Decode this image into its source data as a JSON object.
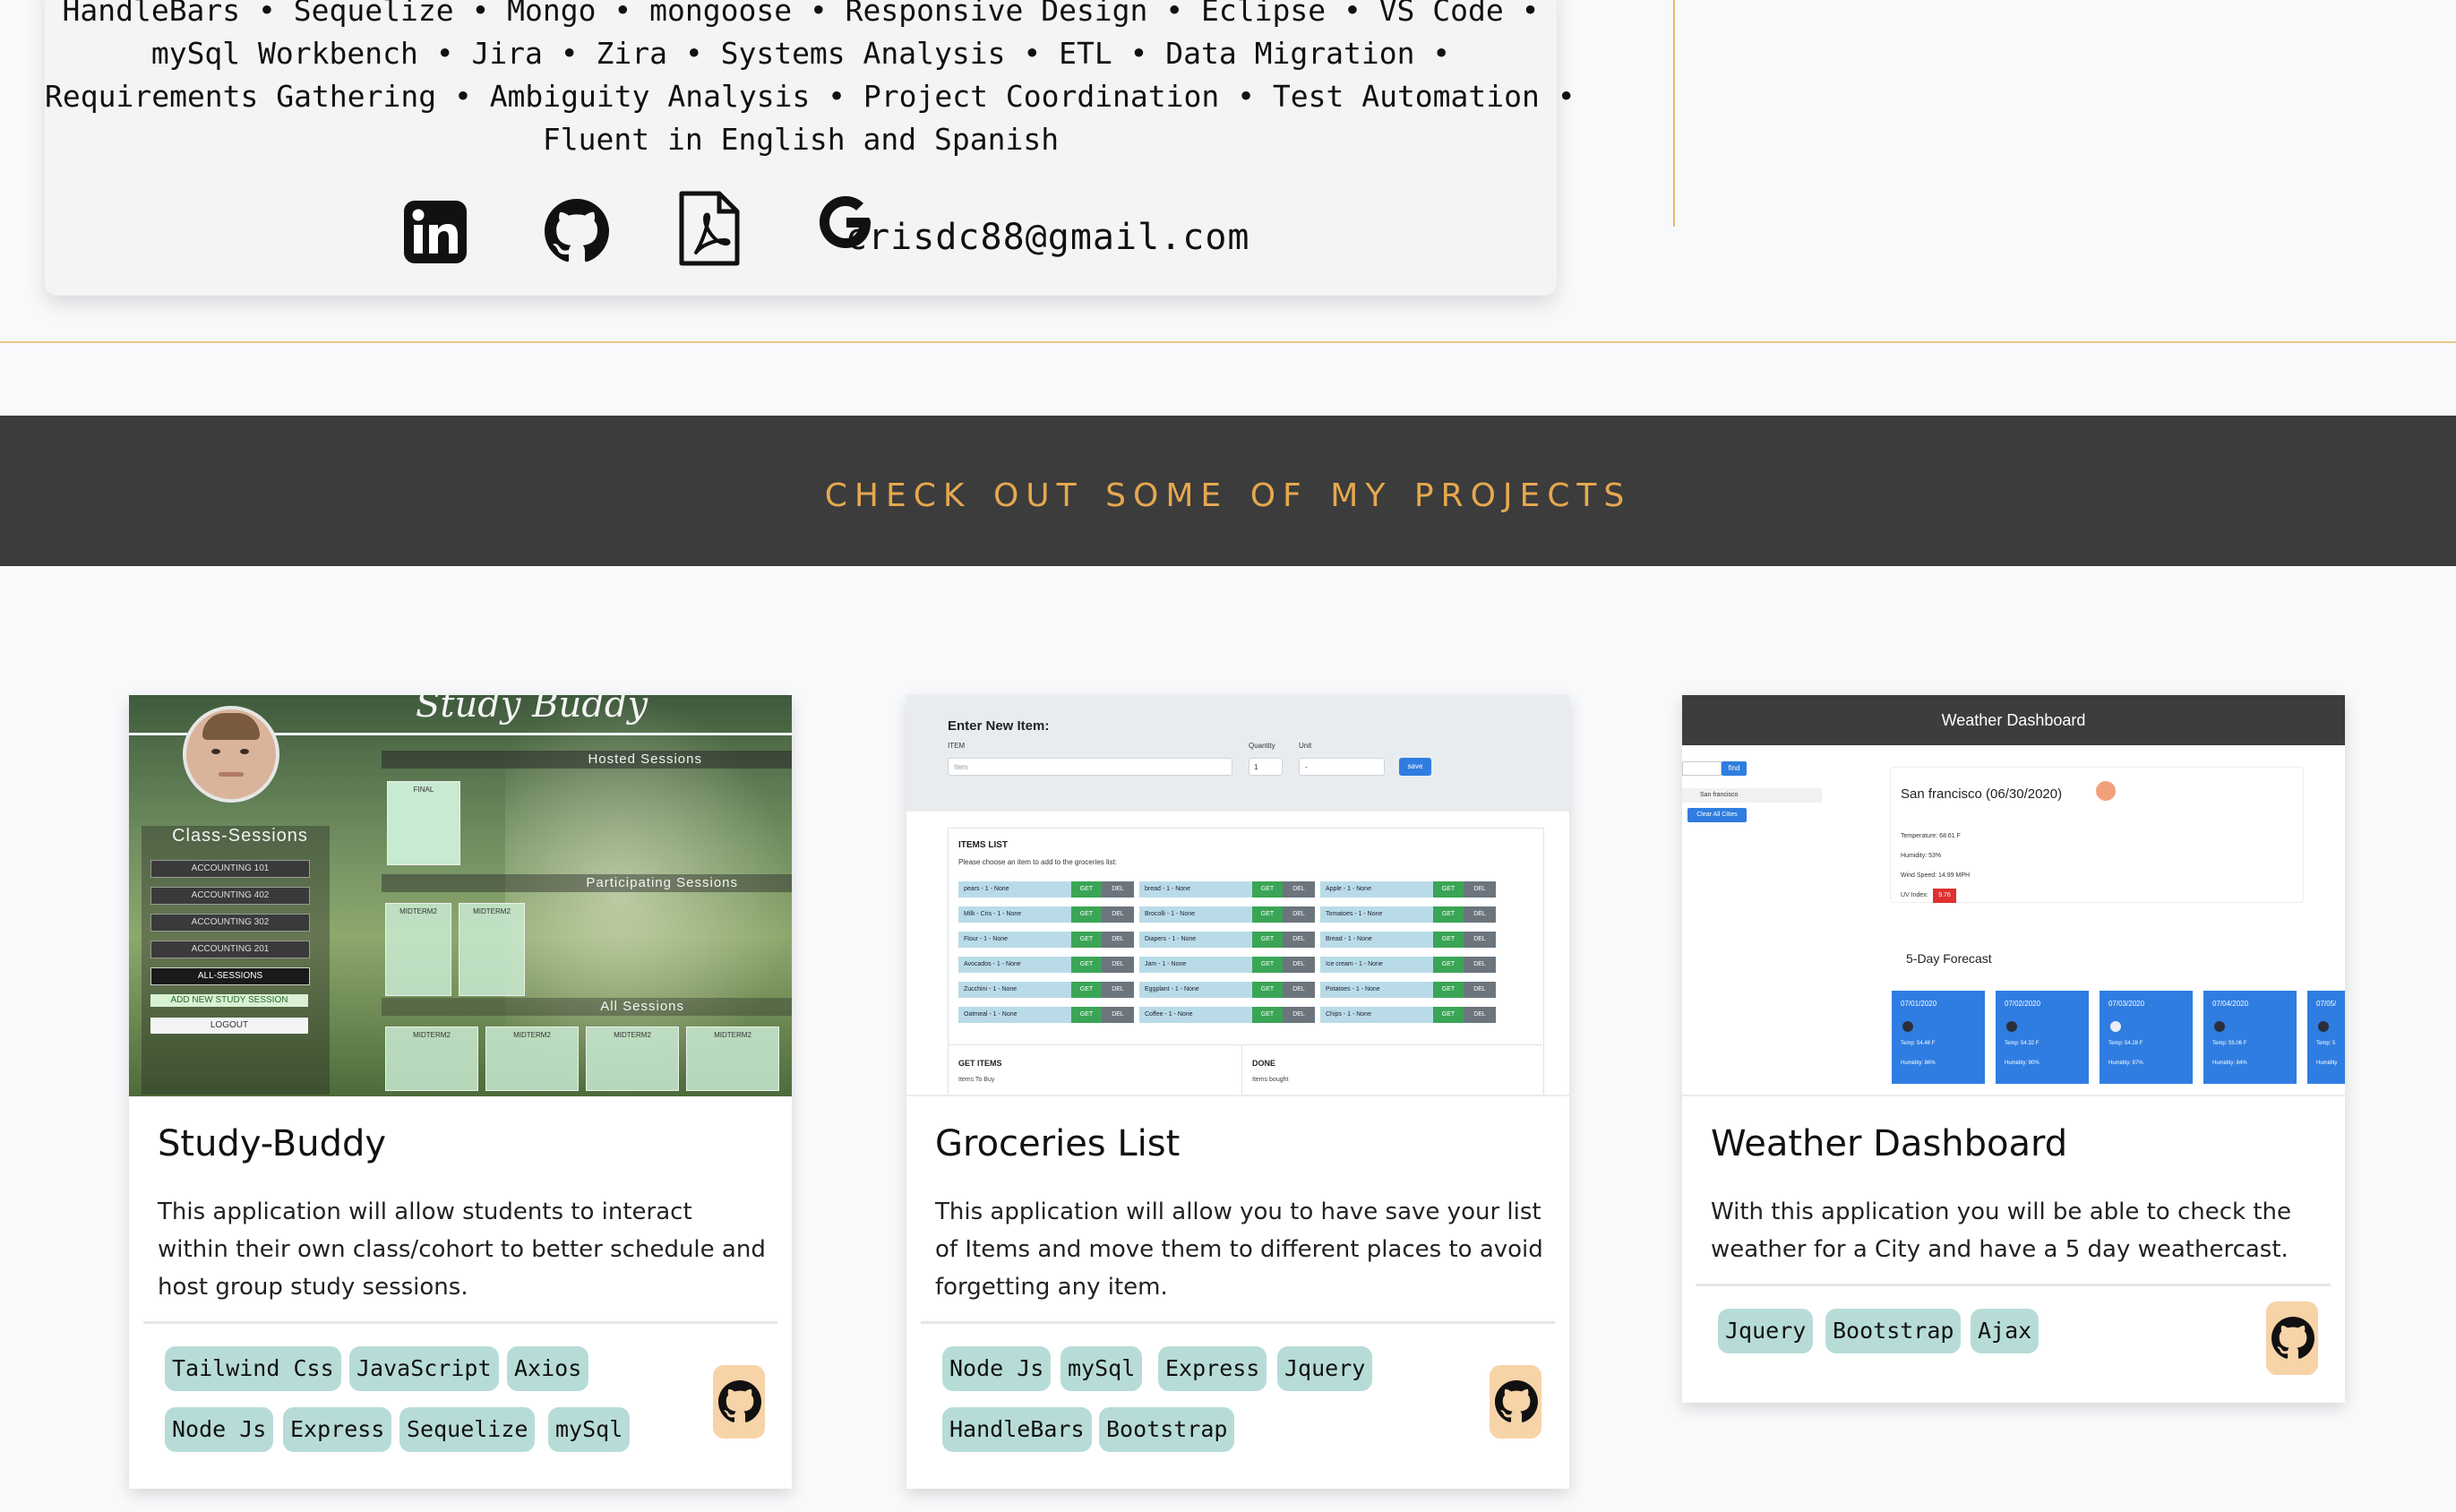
{
  "skills": {
    "lines": [
      "HandleBars • Sequelize • Mongo • mongoose • Responsive Design • Eclipse • VS Code •",
      "mySql Workbench • Jira • Zira • Systems Analysis • ETL • Data Migration •",
      "Requirements Gathering • Ambiguity Analysis • Project Coordination • Test Automation •",
      "Fluent in English and Spanish"
    ],
    "contact": {
      "icons": [
        "linkedin-icon",
        "github-icon",
        "pdf-icon",
        "google-icon"
      ],
      "email": "crisdc88@gmail.com"
    }
  },
  "projects_section": {
    "title": "Check out some of my projects"
  },
  "projects": [
    {
      "title": "Study-Buddy",
      "description": "This application will allow students to interact within their own class/cohort to better schedule and host group study sessions.",
      "tags": [
        "Tailwind Css",
        "JavaScript",
        "Axios",
        "Node Js",
        "Express",
        "Sequelize",
        "mySql"
      ],
      "screenshot": {
        "app_title": "Study Buddy",
        "sidebar_title": "Class-Sessions",
        "sidebar_items": [
          "ACCOUNTING 101",
          "ACCOUNTING 402",
          "ACCOUNTING 302",
          "ACCOUNTING 201",
          "ALL-SESSIONS",
          "ADD NEW STUDY SESSION",
          "LOGOUT"
        ],
        "hosted_label": "Hosted Sessions",
        "participating_label": "Participating Sessions",
        "all_label": "All Sessions",
        "session_card_label": "MIDTERM2",
        "final_label": "FINAL"
      }
    },
    {
      "title": "Groceries List",
      "description": "This application will allow you to have save your list of Items and move them to different places to avoid forgetting any item.",
      "tags": [
        "Node Js",
        "mySql",
        "Express",
        "Jquery",
        "HandleBars",
        "Bootstrap"
      ],
      "screenshot": {
        "heading": "Enter New Item:",
        "item_label": "ITEM",
        "item_placeholder": "Item",
        "quantity_label": "Quantity",
        "quantity_value": "1",
        "unit_label": "Unit",
        "unit_value": "-",
        "save_label": "save",
        "list_title": "ITEMS LIST",
        "list_hint": "Please choose an item to add to the groceries list:",
        "get_label": "GET",
        "del_label": "DEL",
        "columns": [
          [
            "pears - 1 - None",
            "Milk - Cris - 1 - None",
            "Flour - 1 - None",
            "Avocados - 1 - None",
            "Zucchini - 1 - None",
            "Oatmeal - 1 - None"
          ],
          [
            "bread - 1 - None",
            "Brocolli - 1 - None",
            "Diapers - 1 - None",
            "Jam - 1 - None",
            "Eggplant - 1 - None",
            "Coffee - 1 - None"
          ],
          [
            "Apple - 1 - None",
            "Tomatoes - 1 - None",
            "Bread - 1 - None",
            "Ice cream - 1 - None",
            "Potatoes - 1 - None",
            "Chips - 1 - None"
          ]
        ],
        "get_items_title": "GET ITEMS",
        "get_items_sub": "Items To Buy",
        "done_title": "DONE",
        "done_sub": "Items bought"
      }
    },
    {
      "title": "Weather Dashboard",
      "description": "With this application you will be able to check the weather for a City and have a 5 day weathercast.",
      "tags": [
        "Jquery",
        "Bootstrap",
        "Ajax"
      ],
      "screenshot": {
        "header": "Weather Dashboard",
        "find_label": "find",
        "history_item": "San francisco",
        "clear_label": "Clear All Cities",
        "city_title": "San francisco (06/30/2020)",
        "temperature": "Temperature: 68.61 F",
        "humidity": "Humidity: 53%",
        "wind": "Wind Speed: 14.99 MPH",
        "uv_label": "UV Index:",
        "uv_value": "9.76",
        "forecast_title": "5-Day Forecast",
        "forecast": [
          {
            "date": "07/01/2020",
            "temp": "Temp: 54.48 F",
            "humidity": "Humidity: 86%"
          },
          {
            "date": "07/02/2020",
            "temp": "Temp: 54.32 F",
            "humidity": "Humidity: 90%"
          },
          {
            "date": "07/03/2020",
            "temp": "Temp: 54.28 F",
            "humidity": "Humidity: 87%"
          },
          {
            "date": "07/04/2020",
            "temp": "Temp: 55.06 F",
            "humidity": "Humidity: 84%"
          },
          {
            "date": "07/05/",
            "temp": "Temp: 5",
            "humidity": "Humidity"
          }
        ]
      }
    }
  ],
  "colors": {
    "page_bg": "#f8f9fb",
    "banner_bg": "#3c3c3c",
    "banner_text": "#e6a84e",
    "accent_rule": "#ecc78d",
    "tag_bg": "#b7dcd8",
    "github_button_bg": "#f7d3a8"
  }
}
